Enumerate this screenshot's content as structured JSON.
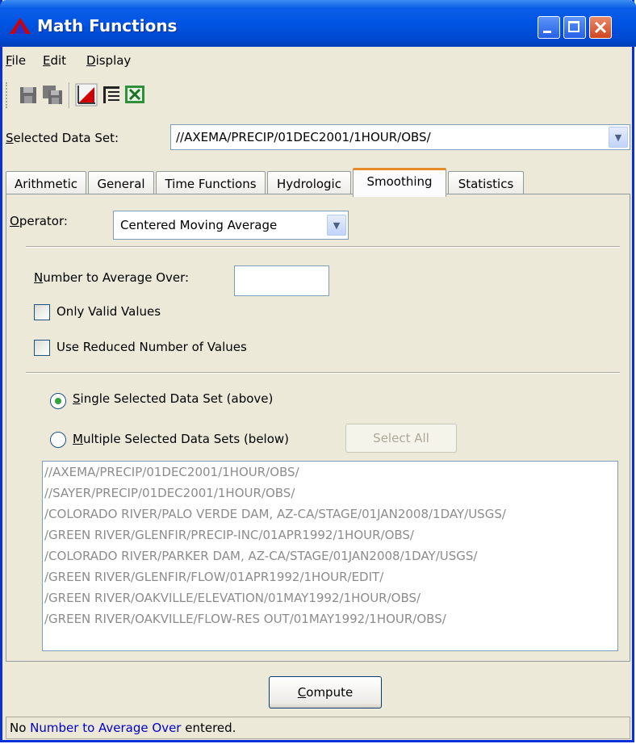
{
  "window": {
    "title": "Math Functions",
    "accent_color": "#0054e3",
    "controls": {
      "minimize_icon": "minimize-icon",
      "maximize_icon": "maximize-icon",
      "close_icon": "close-icon"
    }
  },
  "menubar": {
    "items": [
      {
        "label": "File",
        "mnemonic": "F",
        "rest": "ile"
      },
      {
        "label": "Edit",
        "mnemonic": "E",
        "rest": "dit"
      },
      {
        "label": "Display",
        "mnemonic": "D",
        "rest": "isplay"
      }
    ]
  },
  "toolbar": {
    "icons": [
      "save-icon",
      "save-as-icon",
      "plot-icon",
      "tabulate-icon",
      "excel-icon"
    ]
  },
  "selected_data_set": {
    "label_mnemonic": "S",
    "label_rest": "elected Data Set:",
    "value": "//AXEMA/PRECIP/01DEC2001/1HOUR/OBS/"
  },
  "tabs": [
    {
      "label": "Arithmetic",
      "active": false
    },
    {
      "label": "General",
      "active": false
    },
    {
      "label": "Time Functions",
      "active": false
    },
    {
      "label": "Hydrologic",
      "active": false
    },
    {
      "label": "Smoothing",
      "active": true
    },
    {
      "label": "Statistics",
      "active": false
    }
  ],
  "smoothing": {
    "operator_label_mnemonic": "O",
    "operator_label_rest": "perator:",
    "operator_value": "Centered Moving Average",
    "number_label_mnemonic": "N",
    "number_label_rest": "umber to Average Over:",
    "number_value": "",
    "only_valid_label": "Only Valid Values",
    "only_valid_checked": false,
    "reduced_label": "Use Reduced Number of Values",
    "reduced_checked": false,
    "single_mnemonic": "S",
    "single_rest": "ingle Selected Data Set (above)",
    "single_selected": true,
    "multiple_mnemonic": "M",
    "multiple_rest": "ultiple Selected Data Sets (below)",
    "multiple_selected": false,
    "select_all_label": "Select All",
    "data_sets": [
      "//AXEMA/PRECIP/01DEC2001/1HOUR/OBS/",
      "//SAYER/PRECIP/01DEC2001/1HOUR/OBS/",
      "/COLORADO RIVER/PALO VERDE DAM, AZ-CA/STAGE/01JAN2008/1DAY/USGS/",
      "/GREEN RIVER/GLENFIR/PRECIP-INC/01APR1992/1HOUR/OBS/",
      "/COLORADO RIVER/PARKER DAM, AZ-CA/STAGE/01JAN2008/1DAY/USGS/",
      "/GREEN RIVER/GLENFIR/FLOW/01APR1992/1HOUR/EDIT/",
      "/GREEN RIVER/OAKVILLE/ELEVATION/01MAY1992/1HOUR/OBS/",
      "/GREEN RIVER/OAKVILLE/FLOW-RES OUT/01MAY1992/1HOUR/OBS/"
    ]
  },
  "compute": {
    "mnemonic": "C",
    "rest": "ompute"
  },
  "status": {
    "prefix": "No ",
    "link": "Number to Average Over",
    "suffix": " entered."
  }
}
